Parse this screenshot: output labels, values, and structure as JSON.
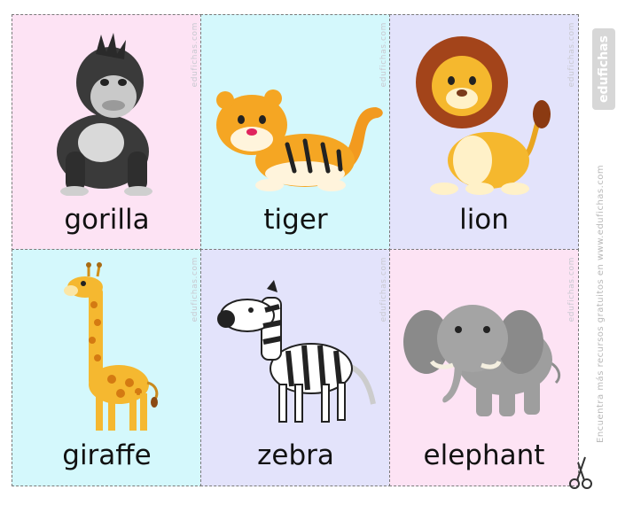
{
  "watermark": "edufichas.com",
  "side_logo_text": "edufichas",
  "side_text": "Encuentra más recursos gratuitos en www.edufichas.com",
  "colors": {
    "pink": "#fde3f4",
    "cyan": "#d4f8fc",
    "lavender": "#e3e3fb",
    "border": "#7a7a7a"
  },
  "cards": [
    {
      "word": "gorilla",
      "bg": "#fde3f4",
      "icon": "gorilla-icon"
    },
    {
      "word": "tiger",
      "bg": "#d4f8fc",
      "icon": "tiger-icon"
    },
    {
      "word": "lion",
      "bg": "#e3e3fb",
      "icon": "lion-icon"
    },
    {
      "word": "giraffe",
      "bg": "#d4f8fc",
      "icon": "giraffe-icon"
    },
    {
      "word": "zebra",
      "bg": "#e3e3fb",
      "icon": "zebra-icon"
    },
    {
      "word": "elephant",
      "bg": "#fde3f4",
      "icon": "elephant-icon"
    }
  ]
}
